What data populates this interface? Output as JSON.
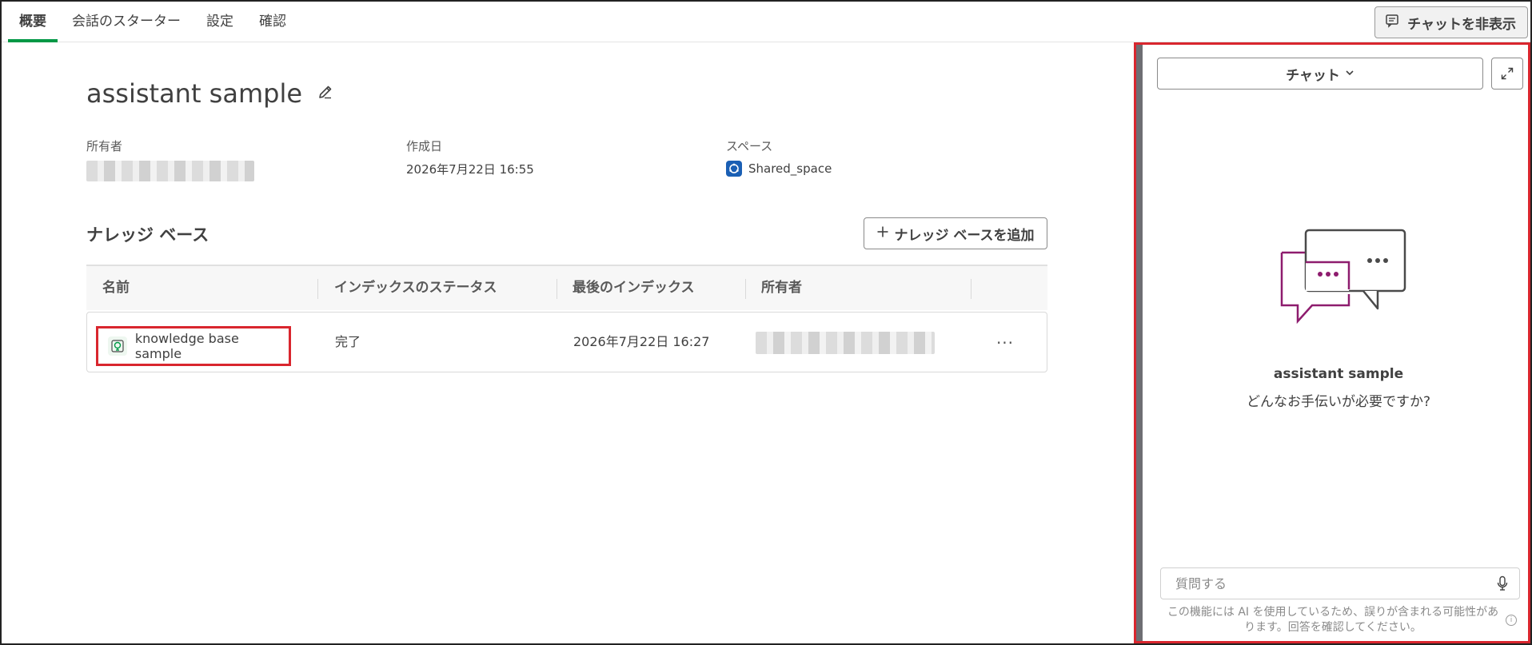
{
  "tabs": [
    {
      "label": "概要",
      "active": true
    },
    {
      "label": "会話のスターター",
      "active": false
    },
    {
      "label": "設定",
      "active": false
    },
    {
      "label": "確認",
      "active": false
    }
  ],
  "header": {
    "hide_chat_label": "チャットを非表示"
  },
  "assistant": {
    "title": "assistant sample",
    "owner_label": "所有者",
    "created_label": "作成日",
    "created_value": "2026年7月22日 16:55",
    "space_label": "スペース",
    "space_value": "Shared_space"
  },
  "knowledge_base": {
    "heading": "ナレッジ ベース",
    "add_button_label": "ナレッジ ベースを追加",
    "columns": [
      "名前",
      "インデックスのステータス",
      "最後のインデックス",
      "所有者"
    ],
    "rows": [
      {
        "name": "knowledge base sample",
        "status": "完了",
        "last_indexed": "2026年7月22日 16:27"
      }
    ]
  },
  "chat": {
    "mode_label": "チャット",
    "assistant_name": "assistant sample",
    "prompt": "どんなお手伝いが必要ですか?",
    "input_placeholder": "質問する",
    "disclaimer": "この機能には AI を使用しているため、誤りが含まれる可能性があります。回答を確認してください。"
  },
  "colors": {
    "accent_green": "#009845",
    "highlight_red": "#d9262e",
    "space_blue": "#1a5fb4",
    "illustration_magenta": "#8e1c6e"
  }
}
